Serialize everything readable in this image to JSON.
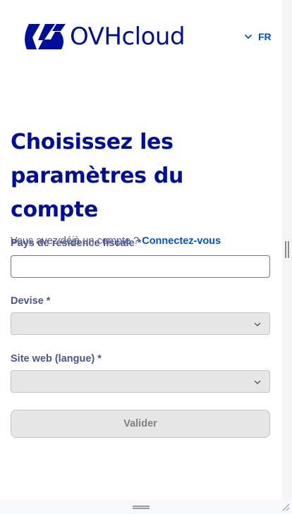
{
  "header": {
    "logo_text": "OVHcloud",
    "language": "FR"
  },
  "page": {
    "title": "Choisissez les paramètres du compte",
    "login_prompt": "Vous avez déjà un compte ?",
    "login_link": "Connectez-vous"
  },
  "form": {
    "country_label": "Pays de résidence fiscale *",
    "country_value": "",
    "currency_label": "Devise *",
    "currency_value": "",
    "website_label": "Site web (langue) *",
    "website_value": "",
    "submit_label": "Valider"
  },
  "colors": {
    "brand": "#000e9c",
    "link": "#0050d7",
    "text": "#4d5592",
    "disabled_bg": "#e6e6e6"
  },
  "icons": {
    "language_dropdown": "chevron-down-icon",
    "select": "chevron-down-icon"
  }
}
